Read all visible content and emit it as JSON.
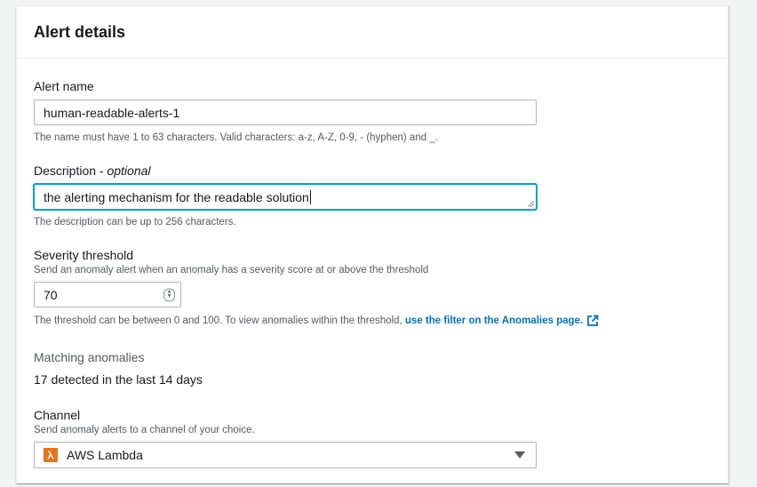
{
  "panel": {
    "title": "Alert details"
  },
  "alert_name": {
    "label": "Alert name",
    "value": "human-readable-alerts-1",
    "hint": "The name must have 1 to 63 characters. Valid characters: a-z, A-Z, 0-9, - (hyphen) and _."
  },
  "description": {
    "label": "Description - ",
    "label_optional": "optional",
    "value": "the alerting mechanism for the readable solution",
    "hint": "The description can be up to 256 characters."
  },
  "severity": {
    "label": "Severity threshold",
    "subtext": "Send an anomaly alert when an anomaly has a severity score at or above the threshold",
    "value": "70",
    "hint": "The threshold can be between 0 and 100. To view anomalies within the threshold, ",
    "link": "use the filter on the Anomalies page.",
    "link_icon": "external-link-icon"
  },
  "matching": {
    "label": "Matching anomalies",
    "value": "17 detected in the last 14 days"
  },
  "channel": {
    "label": "Channel",
    "subtext": "Send anomaly alerts to a channel of your choice.",
    "selected": "AWS Lambda",
    "icon": "aws-lambda-icon"
  },
  "colors": {
    "link": "#0073bb",
    "focus": "#00a1c9",
    "lambda": "#e7731b"
  }
}
